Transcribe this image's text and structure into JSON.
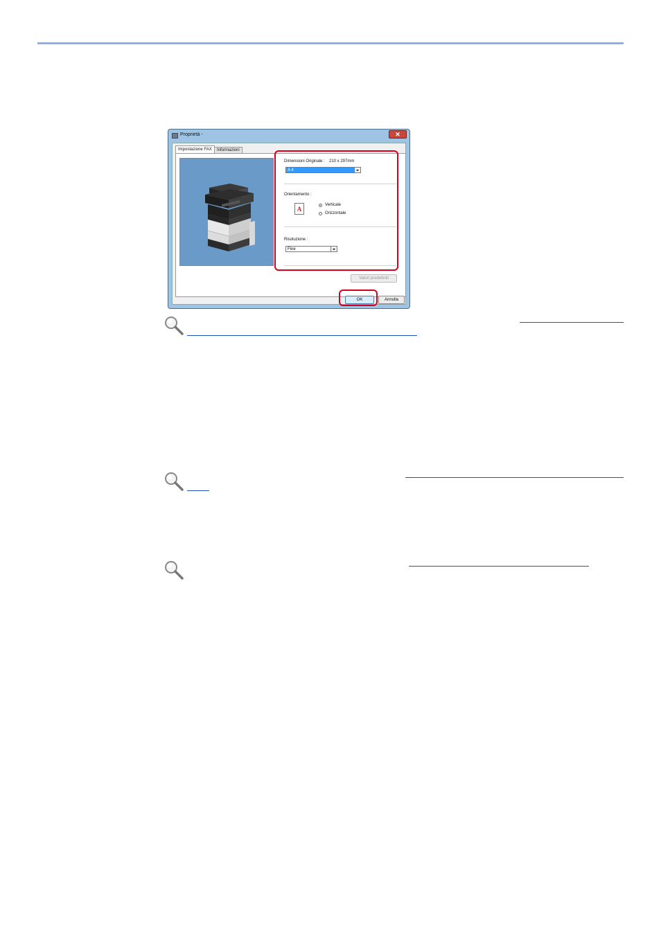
{
  "dialog": {
    "title": "Proprietà -",
    "tabs": [
      {
        "label": "Impostazione FAX",
        "active": true
      },
      {
        "label": "Informazioni",
        "active": false
      }
    ],
    "original_size": {
      "label": "Dimensioni Originale :",
      "dimensions": "210 x 297mm",
      "selected": "A 4"
    },
    "orientation": {
      "label": "Orientamento :",
      "icon_letter": "A",
      "options": [
        {
          "label": "Verticale",
          "selected": true
        },
        {
          "label": "Orizzontale",
          "selected": false
        }
      ]
    },
    "resolution": {
      "label": "Risoluzione :",
      "selected": "Fine"
    },
    "defaults_button": "Valori predefiniti",
    "ok_button": "OK",
    "cancel_button": "Annulla"
  },
  "colors": {
    "rule": "#8fb0e6",
    "highlight": "#d6001c",
    "link": "#1f4fbf",
    "preview_bg": "#6a9ac8"
  }
}
